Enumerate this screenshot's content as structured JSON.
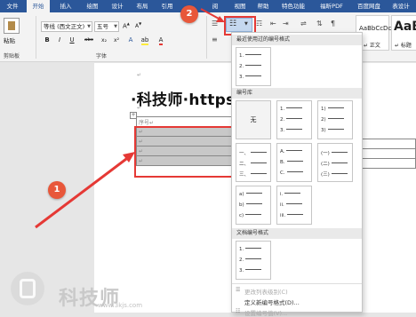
{
  "tabs": [
    "文件",
    "开始",
    "插入",
    "绘图",
    "设计",
    "布局",
    "引用",
    "阅",
    "视图",
    "帮助",
    "特色功能",
    "福昕PDF",
    "百度网盘",
    "表设计"
  ],
  "ribbon": {
    "paste_label": "粘贴",
    "clipboard_label": "剪贴板",
    "font_name": "等线 (西文正文)",
    "font_size": "五号",
    "font_group_label": "字体",
    "format_buttons": [
      "B",
      "I",
      "U",
      "abc",
      "x₂",
      "x²"
    ],
    "styles": [
      {
        "sample": "AaBbCcDc",
        "name": "↵ 正文"
      },
      {
        "sample": "AaBl",
        "name": "↵ 标题"
      }
    ]
  },
  "document": {
    "heading": "·科技师·https:/",
    "table_header_cell": "序号↵",
    "table_rows": [
      "↵",
      "↵",
      "↵",
      "↵"
    ]
  },
  "annotations": {
    "badge1": "1",
    "badge2": "2"
  },
  "panel": {
    "recent_title": "最近使用过的编号格式",
    "recent": [
      [
        "1.",
        "2.",
        "3."
      ]
    ],
    "library_title": "编号库",
    "none_label": "无",
    "library": [
      [
        "1.",
        "2.",
        "3."
      ],
      [
        "1)",
        "2)",
        "3)"
      ],
      [
        "一、",
        "二、",
        "三、"
      ],
      [
        "A.",
        "B.",
        "C."
      ],
      [
        "(一)",
        "(二)",
        "(三)"
      ],
      [
        "a)",
        "b)",
        "c)"
      ],
      [
        "i.",
        "ii.",
        "iii."
      ]
    ],
    "doc_title": "文档编号格式",
    "doc": [
      [
        "1.",
        "2.",
        "3."
      ]
    ],
    "menu": [
      {
        "label": "更改列表级别(C)",
        "disabled": true
      },
      {
        "label": "定义新编号格式(D)...",
        "disabled": false
      },
      {
        "label": "设置编号值(V)...",
        "disabled": true
      }
    ]
  },
  "watermark": {
    "brand": "科技师",
    "url": "www.3kjs.com"
  },
  "colors": {
    "ribbon_blue": "#2b579a",
    "annotation_red": "#e53935",
    "badge_orange": "#e8573a"
  }
}
